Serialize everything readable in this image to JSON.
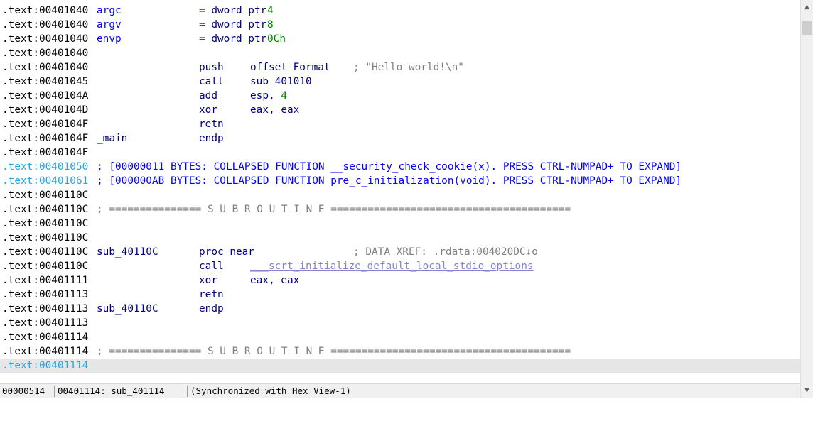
{
  "disassembly": {
    "lines": [
      {
        "addr": ".text:00401040",
        "addr_style": "normal",
        "label": "argc",
        "label_style": "name",
        "op": "= dword ptr",
        "operand": "4",
        "operand_style": "num",
        "comment": ""
      },
      {
        "addr": ".text:00401040",
        "addr_style": "normal",
        "label": "argv",
        "label_style": "name",
        "op": "= dword ptr",
        "operand": "8",
        "operand_style": "num",
        "comment": ""
      },
      {
        "addr": ".text:00401040",
        "addr_style": "normal",
        "label": "envp",
        "label_style": "name",
        "op": "= dword ptr",
        "operand": "0Ch",
        "operand_style": "num",
        "comment": ""
      },
      {
        "addr": ".text:00401040",
        "addr_style": "normal",
        "label": "",
        "op": "",
        "operand": "",
        "comment": ""
      },
      {
        "addr": ".text:00401040",
        "addr_style": "normal",
        "label": "",
        "op": "push",
        "operand": "offset Format",
        "operand_style": "op",
        "comment": "; \"Hello world!\\n\""
      },
      {
        "addr": ".text:00401045",
        "addr_style": "normal",
        "label": "",
        "op": "call",
        "operand": "sub_401010",
        "operand_style": "op",
        "comment": ""
      },
      {
        "addr": ".text:0040104A",
        "addr_style": "normal",
        "label": "",
        "op": "add",
        "operand": "esp, 4",
        "operand_style": "mixed",
        "comment": ""
      },
      {
        "addr": ".text:0040104D",
        "addr_style": "normal",
        "label": "",
        "op": "xor",
        "operand": "eax, eax",
        "operand_style": "op",
        "comment": ""
      },
      {
        "addr": ".text:0040104F",
        "addr_style": "normal",
        "label": "",
        "op": "retn",
        "operand": "",
        "comment": ""
      },
      {
        "addr": ".text:0040104F",
        "addr_style": "normal",
        "label": "_main",
        "label_style": "label",
        "op": "endp",
        "operand": "",
        "comment": ""
      },
      {
        "addr": ".text:0040104F",
        "addr_style": "normal",
        "label": "",
        "op": "",
        "operand": "",
        "comment": ""
      },
      {
        "addr": ".text:00401050",
        "addr_style": "cyan",
        "collapsed": "; [00000011 BYTES: COLLAPSED FUNCTION __security_check_cookie(x). PRESS CTRL-NUMPAD+ TO EXPAND]"
      },
      {
        "addr": ".text:00401061",
        "addr_style": "cyan",
        "collapsed": "; [000000AB BYTES: COLLAPSED FUNCTION pre_c_initialization(void). PRESS CTRL-NUMPAD+ TO EXPAND]"
      },
      {
        "addr": ".text:0040110C",
        "addr_style": "normal",
        "label": "",
        "op": "",
        "operand": "",
        "comment": ""
      },
      {
        "addr": ".text:0040110C",
        "addr_style": "normal",
        "separator": "; =============== S U B R O U T I N E ======================================="
      },
      {
        "addr": ".text:0040110C",
        "addr_style": "normal",
        "label": "",
        "op": "",
        "operand": "",
        "comment": ""
      },
      {
        "addr": ".text:0040110C",
        "addr_style": "normal",
        "label": "",
        "op": "",
        "operand": "",
        "comment": ""
      },
      {
        "addr": ".text:0040110C",
        "addr_style": "normal",
        "label": "sub_40110C",
        "label_style": "label",
        "op": "proc near",
        "operand": "",
        "comment": "; DATA XREF: .rdata:004020DC↓o"
      },
      {
        "addr": ".text:0040110C",
        "addr_style": "normal",
        "label": "",
        "op": "call",
        "operand": "___scrt_initialize_default_local_stdio_options",
        "operand_style": "external",
        "comment": ""
      },
      {
        "addr": ".text:00401111",
        "addr_style": "normal",
        "label": "",
        "op": "xor",
        "operand": "eax, eax",
        "operand_style": "op",
        "comment": ""
      },
      {
        "addr": ".text:00401113",
        "addr_style": "normal",
        "label": "",
        "op": "retn",
        "operand": "",
        "comment": ""
      },
      {
        "addr": ".text:00401113",
        "addr_style": "normal",
        "label": "sub_40110C",
        "label_style": "label",
        "op": "endp",
        "operand": "",
        "comment": ""
      },
      {
        "addr": ".text:00401113",
        "addr_style": "normal",
        "label": "",
        "op": "",
        "operand": "",
        "comment": ""
      },
      {
        "addr": ".text:00401114",
        "addr_style": "normal",
        "label": "",
        "op": "",
        "operand": "",
        "comment": ""
      },
      {
        "addr": ".text:00401114",
        "addr_style": "normal",
        "separator": "; =============== S U B R O U T I N E ======================================="
      },
      {
        "addr": ".text:00401114",
        "addr_style": "cyan",
        "current": true,
        "label": "",
        "op": "",
        "operand": "",
        "comment": ""
      }
    ]
  },
  "statusbar": {
    "offset": "00000514",
    "location": "00401114: sub_401114",
    "sync": "(Synchronized with Hex View-1)"
  },
  "scrollbar": {
    "up_icon": "scroll-up-arrow",
    "down_icon": "scroll-down-arrow"
  },
  "colors": {
    "address": "#000000",
    "address_highlight": "#21a6e6",
    "instruction": "#000080",
    "name": "#0000ff",
    "number": "#008000",
    "comment": "#808080",
    "collapsed": "#0000ff",
    "external": "#8484d0",
    "current_line": "#e6e6e6"
  }
}
